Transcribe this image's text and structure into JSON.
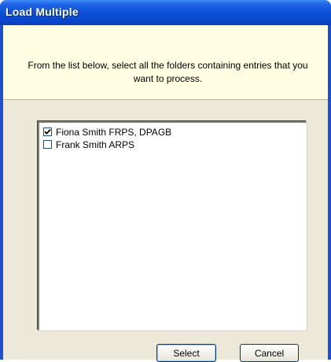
{
  "window": {
    "title": "Load Multiple"
  },
  "info": {
    "message": "From the list below, select all the folders containing entries that you want to process."
  },
  "folders": [
    {
      "label": "Fiona Smith FRPS, DPAGB",
      "checked": true
    },
    {
      "label": "Frank Smith ARPS",
      "checked": false
    }
  ],
  "buttons": {
    "select_label": "Select",
    "cancel_label": "Cancel"
  }
}
